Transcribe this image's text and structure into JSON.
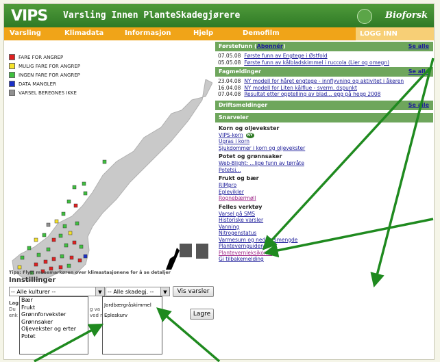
{
  "header": {
    "logo": "VIPS",
    "title": "Varsling Innen PlanteSkadegjørere",
    "brand": "Bioforsk",
    "brand_color": "#2f7a26"
  },
  "nav": {
    "items": [
      "Varsling",
      "Klimadata",
      "Informasjon",
      "Hjelp",
      "Demofilm"
    ],
    "login": "LOGG INN",
    "color": "#f0a418"
  },
  "legend": [
    {
      "label": "FARE FOR ANGREP",
      "color": "#e02020"
    },
    {
      "label": "MULIG FARE FOR ANGREP",
      "color": "#f5e22a"
    },
    {
      "label": "INGEN FARE FOR ANGREP",
      "color": "#3fbf3f"
    },
    {
      "label": "DATA MANGLER",
      "color": "#1a2fc8"
    },
    {
      "label": "VARSEL BEREGNES IKKE",
      "color": "#909090"
    }
  ],
  "tips": "Tips: Flytt musemarkøren over klimastasjonene for å se detaljer",
  "settings": {
    "heading": "Innstillinger",
    "culture_select": "-- Alle kulturer --",
    "pest_select": "-- Alle skadegj. --",
    "show_button": "Vis varsler",
    "save_button": "Lagre",
    "hidden_text": [
      "Lag",
      "Du",
      "enk",
      "g va",
      "ved n"
    ]
  },
  "culture_options": [
    "Bær",
    "Frukt",
    "Grønnforvekster",
    "Grønnsaker",
    "Oljevekster og erter",
    "Potet"
  ],
  "pest_options": [
    "Jordbærgråskimmel",
    "Epleskurv"
  ],
  "forstefunn": {
    "title": "Førstefunn",
    "subscribe": "Abonnér",
    "see_all": "Se alle",
    "items": [
      {
        "date": "07.05.08",
        "text": "Første funn av Engtege i Østfold"
      },
      {
        "date": "05.05.08",
        "text": "Første funn av kålbladskimmel i ruccola (Lier og omegn)"
      }
    ]
  },
  "fagmeldinger": {
    "title": "Fagmeldinger",
    "see_all": "Se alle",
    "items": [
      {
        "date": "23.04.08",
        "text": "NY modell for håret engtege - innflyvning og aktivitet i åkeren"
      },
      {
        "date": "16.04.08",
        "text": "NY modell for Liten kålflue - sverm. dspunkt"
      },
      {
        "date": "07.04.08",
        "text": "Resultat etter opptelling av blad... egg på hegg 2008"
      }
    ]
  },
  "driftsmeldinger": {
    "title": "Driftsmeldinger",
    "see_all": "Se alle"
  },
  "snarveier": {
    "title": "Snarveier",
    "groups": [
      {
        "heading": "Korn og oljevekster",
        "links": [
          "VIPS-korn",
          "Ugras i korn",
          "Sjukdommer i korn og oljevekster"
        ],
        "badge": "NY"
      },
      {
        "heading": "Potet og grønnsaker",
        "links": [
          "Web-Blight: ...lige funn av tørråte",
          "Potetsi..."
        ]
      },
      {
        "heading": "Frukt og bær",
        "links": [
          "RIMpro",
          "Eplevikler",
          "Rognebærmøll"
        ]
      },
      {
        "heading": "Felles verktøy",
        "links": [
          "Varsel på SMS",
          "Historiske varsler",
          "Vanning",
          "Nitrogenstatus",
          "Varmesum og nedbørsmengde",
          "Plantevernguiden",
          "Plantevernleksikonet",
          "Gi tilbakemelding"
        ]
      }
    ]
  }
}
